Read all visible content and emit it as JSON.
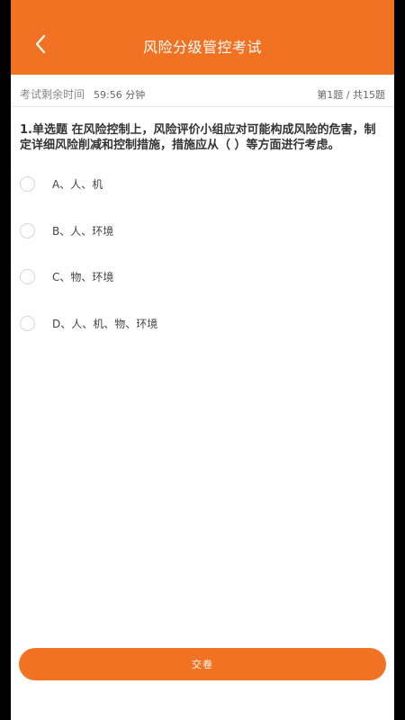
{
  "header": {
    "title": "风险分级管控考试"
  },
  "exam": {
    "timer_label": "考试剩余时间",
    "timer_value": "59:56 分钟",
    "progress": "第1题 / 共15题"
  },
  "question": {
    "text": "1.单选题 在风险控制上，风险评价小组应对可能构成风险的危害，制定详细风险削减和控制措施，措施应从（ ）等方面进行考虑。",
    "options": [
      {
        "label": "A、人、机"
      },
      {
        "label": "B、人、环境"
      },
      {
        "label": "C、物、环境"
      },
      {
        "label": "D、人、机、物、环境"
      }
    ]
  },
  "footer": {
    "submit_label": "交卷"
  },
  "colors": {
    "accent": "#f27224"
  },
  "icons": {
    "back": "chevron-left-icon"
  }
}
